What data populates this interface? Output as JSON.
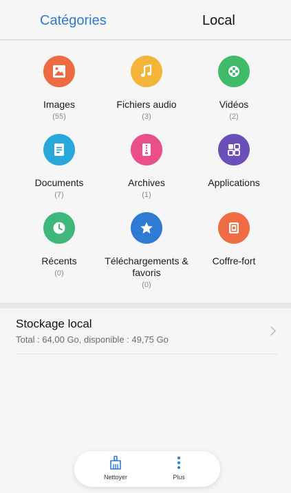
{
  "tabs": {
    "categories_label": "Catégories",
    "local_label": "Local",
    "active": "categories"
  },
  "colors": {
    "accent": "#2f7bd3",
    "images": "#ec6b43",
    "audio": "#f4b43a",
    "videos": "#3fbb67",
    "documents": "#28a7d8",
    "archives": "#ea4f89",
    "applications": "#6b4fb8",
    "recents": "#3fb77a",
    "downloads": "#2f7bd3",
    "safe": "#ef6c45"
  },
  "categories": [
    {
      "label": "Images",
      "count": "(55)",
      "icon": "image-icon"
    },
    {
      "label": "Fichiers audio",
      "count": "(3)",
      "icon": "music-icon"
    },
    {
      "label": "Vidéos",
      "count": "(2)",
      "icon": "video-reel-icon"
    },
    {
      "label": "Documents",
      "count": "(7)",
      "icon": "document-icon"
    },
    {
      "label": "Archives",
      "count": "(1)",
      "icon": "archive-icon"
    },
    {
      "label": "Applications",
      "count": "",
      "icon": "apps-icon"
    },
    {
      "label": "Récents",
      "count": "(0)",
      "icon": "clock-icon"
    },
    {
      "label": "Téléchargements & favoris",
      "count": "(0)",
      "icon": "star-icon"
    },
    {
      "label": "Coffre-fort",
      "count": "",
      "icon": "safe-icon"
    }
  ],
  "storage": {
    "title": "Stockage local",
    "detail": "Total : 64,00  Go, disponible : 49,75  Go"
  },
  "bottom_bar": {
    "clean_label": "Nettoyer",
    "more_label": "Plus"
  }
}
